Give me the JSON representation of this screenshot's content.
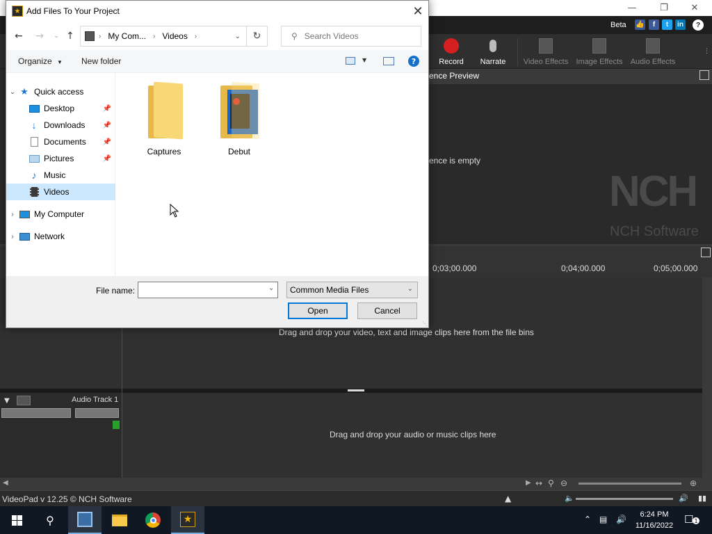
{
  "app": {
    "beta_label": "Beta",
    "toolbar": {
      "record": "Record",
      "narrate": "Narrate",
      "video_effects": "Video Effects",
      "image_effects": "Image Effects",
      "audio_effects": "Audio Effects"
    },
    "preview_header": "ence Preview",
    "sequence_empty": "ence is empty",
    "nch_logo": "NCH",
    "nch_software": "NCH Software",
    "ruler_ticks": [
      "0;03;00.000",
      "0;04;00.000",
      "0;05;00.000"
    ],
    "video_hint": "Drag and drop your video, text and image clips here from the file bins",
    "audio_track_label": "Audio Track 1",
    "audio_hint": "Drag and drop your audio or music clips here",
    "status_text": "VideoPad v 12.25 © NCH Software"
  },
  "dialog": {
    "title": "Add Files To Your Project",
    "breadcrumb": [
      "My Com...",
      "Videos"
    ],
    "search_placeholder": "Search Videos",
    "organize": "Organize",
    "new_folder": "New folder",
    "tree": [
      {
        "label": "Quick access"
      },
      {
        "label": "Desktop"
      },
      {
        "label": "Downloads"
      },
      {
        "label": "Documents"
      },
      {
        "label": "Pictures"
      },
      {
        "label": "Music"
      },
      {
        "label": "Videos"
      },
      {
        "label": "My Computer"
      },
      {
        "label": "Network"
      }
    ],
    "folders": [
      {
        "label": "Captures"
      },
      {
        "label": "Debut"
      }
    ],
    "file_name_label": "File name:",
    "file_name_value": "",
    "file_type": "Common Media Files",
    "open": "Open",
    "cancel": "Cancel"
  },
  "taskbar": {
    "time": "6:24 PM",
    "date": "11/16/2022"
  },
  "colors": {
    "accent": "#0078d7",
    "record_red": "#d42020",
    "selection": "#cce8ff"
  }
}
